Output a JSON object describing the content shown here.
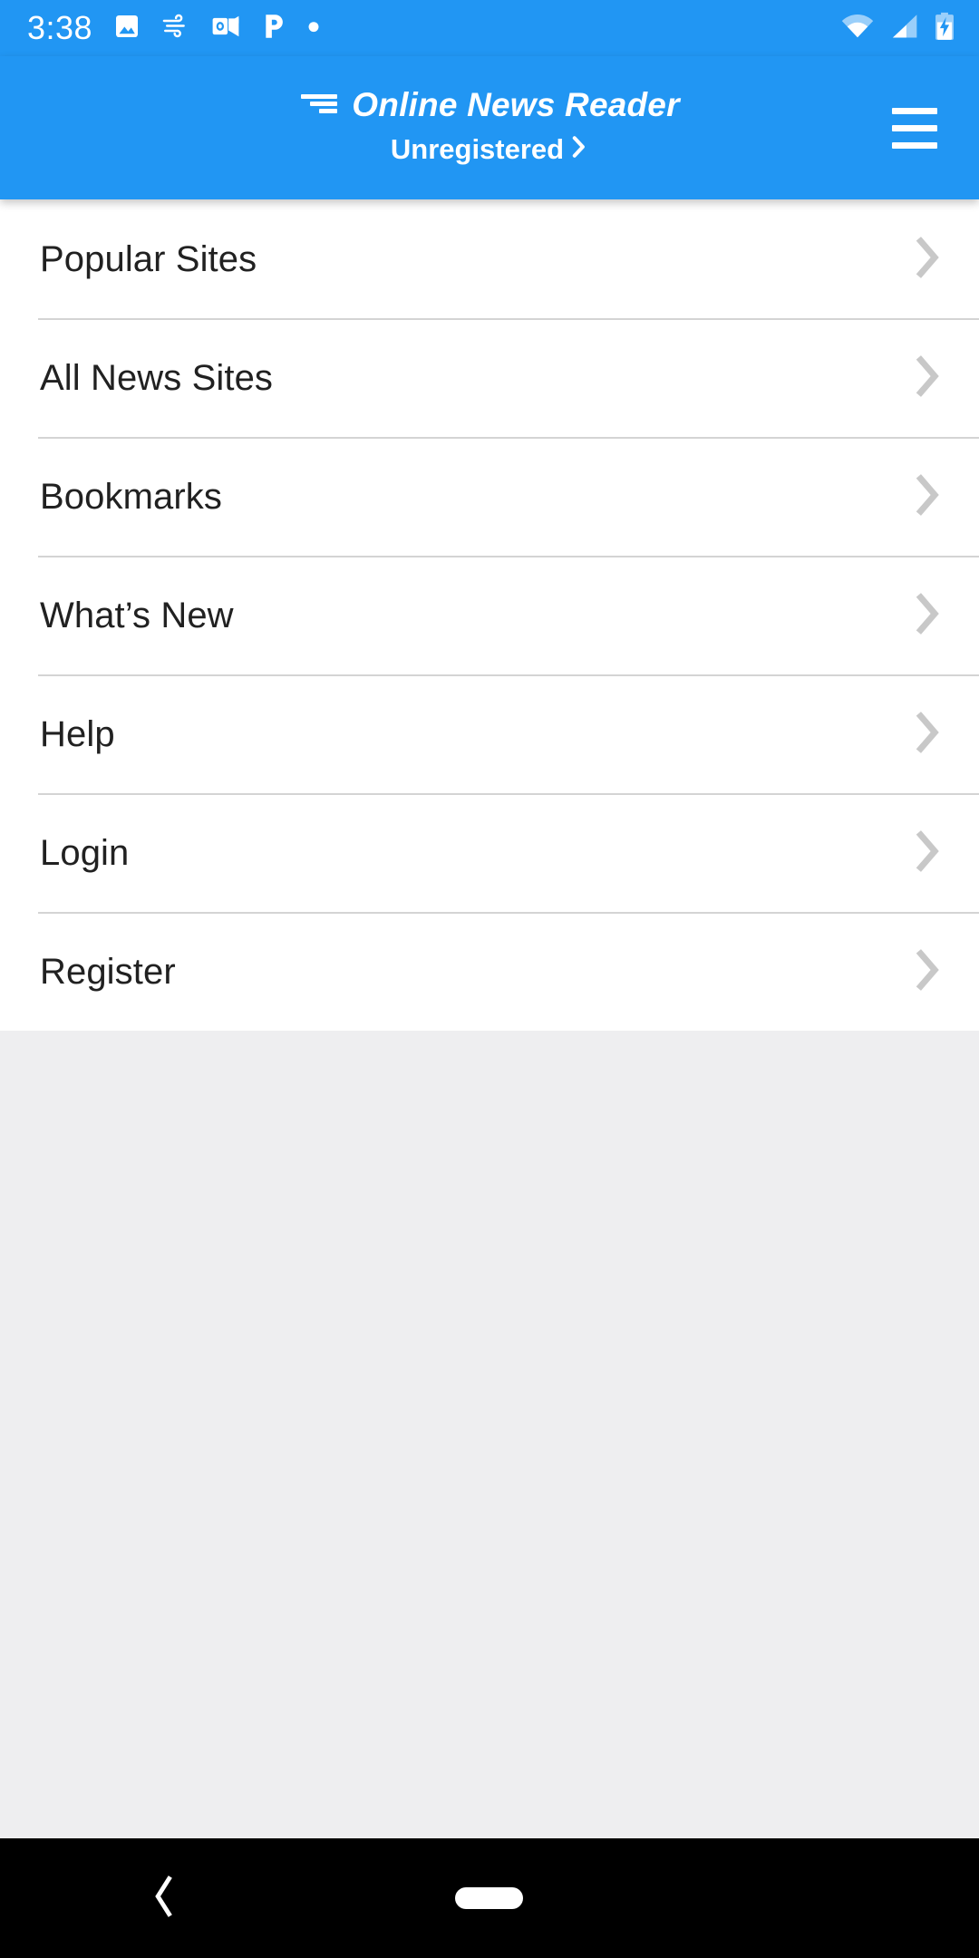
{
  "status_bar": {
    "time": "3:38",
    "notification_icons": [
      "photos-icon",
      "weather-wind-icon",
      "outlook-icon",
      "pandora-icon",
      "dot-icon"
    ],
    "system_icons": [
      "wifi-icon",
      "cellular-signal-icon",
      "battery-charging-icon"
    ]
  },
  "app_bar": {
    "logo_icon": "news-lines-logo-icon",
    "title": "Online News Reader",
    "account_status": "Unregistered",
    "account_chevron_icon": "chevron-right-icon",
    "menu_icon": "hamburger-menu-icon"
  },
  "menu": {
    "items": [
      {
        "label": "Popular Sites",
        "chevron": "chevron-right-icon"
      },
      {
        "label": "All News Sites",
        "chevron": "chevron-right-icon"
      },
      {
        "label": "Bookmarks",
        "chevron": "chevron-right-icon"
      },
      {
        "label": "What’s New",
        "chevron": "chevron-right-icon"
      },
      {
        "label": "Help",
        "chevron": "chevron-right-icon"
      },
      {
        "label": "Login",
        "chevron": "chevron-right-icon"
      },
      {
        "label": "Register",
        "chevron": "chevron-right-icon"
      }
    ]
  },
  "navigation_bar": {
    "back_icon": "back-chevron-icon",
    "home_indicator": "home-pill-indicator"
  },
  "colors": {
    "brand_blue": "#2196f3",
    "page_background": "#eeeef0",
    "card_background": "#ffffff",
    "row_text": "#212121",
    "chevron_gray": "#c8c8c8",
    "divider": "#d4d4d4",
    "nav_background": "#000000"
  }
}
